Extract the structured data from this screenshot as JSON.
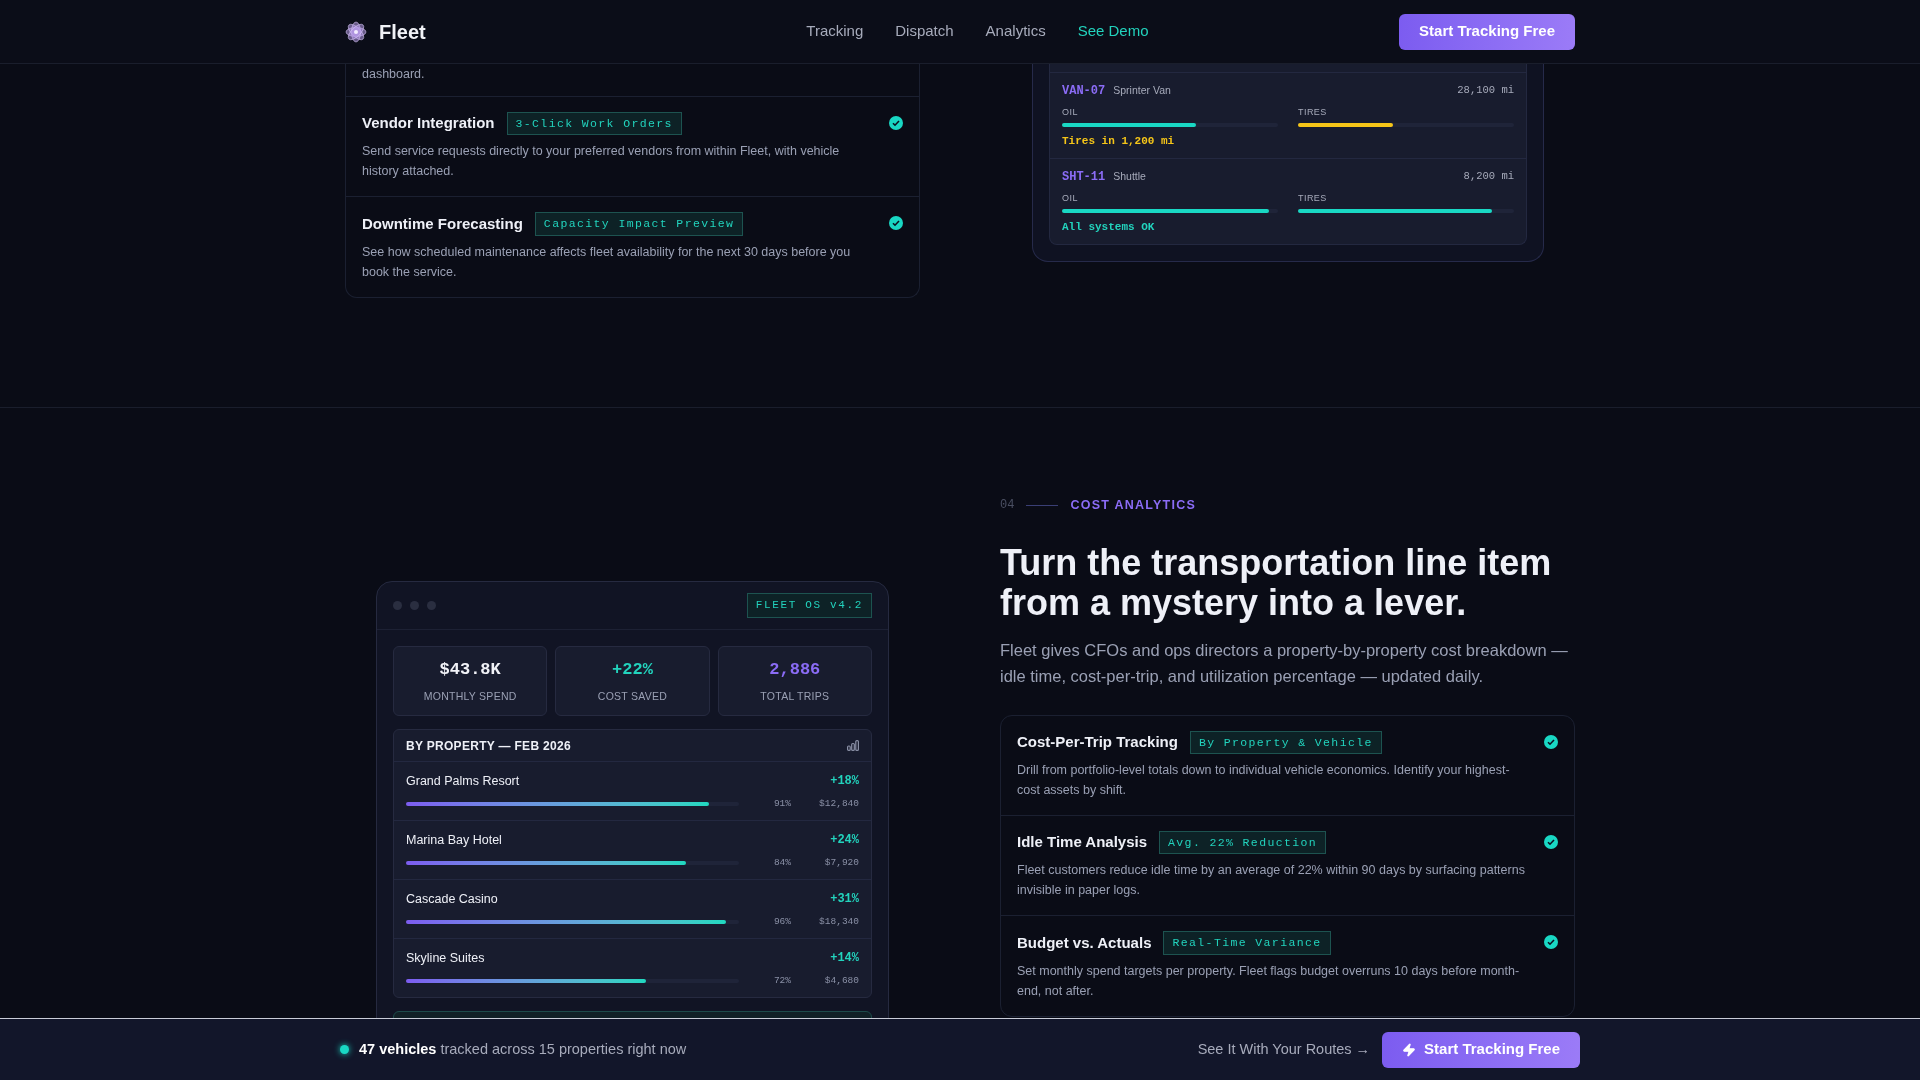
{
  "nav": {
    "brand": "Fleet",
    "links": [
      {
        "label": "Tracking",
        "kind": "plain"
      },
      {
        "label": "Dispatch",
        "kind": "plain"
      },
      {
        "label": "Analytics",
        "kind": "plain"
      },
      {
        "label": "See Demo",
        "kind": "accent"
      }
    ],
    "cta": "Start Tracking Free"
  },
  "maintenance": {
    "partial_description": "dashboard.",
    "features": [
      {
        "title": "Vendor Integration",
        "tag": "3-Click Work Orders",
        "description": "Send service requests directly to your preferred vendors from within Fleet, with vehicle history attached.",
        "checked": true
      },
      {
        "title": "Downtime Forecasting",
        "tag": "Capacity Impact Preview",
        "description": "See how scheduled maintenance affects fleet availability for the next 30 days before you book the service.",
        "checked": true
      }
    ],
    "vehicles": [
      {
        "id": "VAN-07",
        "type": "Sprinter Van",
        "mileage": "28,100 mi",
        "gauges": [
          {
            "label": "OIL",
            "level": 0.62,
            "color": "#19d8c4"
          },
          {
            "label": "TIRES",
            "level": 0.44,
            "color": "#f5c518"
          }
        ],
        "status": {
          "text": "Tires in 1,200 mi",
          "color": "#f5c518"
        }
      },
      {
        "id": "SHT-11",
        "type": "Shuttle",
        "mileage": "8,200 mi",
        "gauges": [
          {
            "label": "OIL",
            "level": 0.96,
            "color": "#19d8c4"
          },
          {
            "label": "TIRES",
            "level": 0.9,
            "color": "#19d8c4"
          }
        ],
        "status": {
          "text": "All systems OK",
          "color": "#22d3bd"
        }
      }
    ]
  },
  "analytics": {
    "number": "04",
    "eyebrow": "COST ANALYTICS",
    "heading": "Turn the transportation line item from a mystery into a lever.",
    "paragraph": "Fleet gives CFOs and ops directors a property-by-property cost breakdown — idle time, cost-per-trip, and utilization percentage — updated daily.",
    "features": [
      {
        "title": "Cost-Per-Trip Tracking",
        "tag": "By Property & Vehicle",
        "description": "Drill from portfolio-level totals down to individual vehicle economics. Identify your highest-cost assets by shift.",
        "checked": true
      },
      {
        "title": "Idle Time Analysis",
        "tag": "Avg. 22% Reduction",
        "description": "Fleet customers reduce idle time by an average of 22% within 90 days by surfacing patterns invisible in paper logs.",
        "checked": true
      },
      {
        "title": "Budget vs. Actuals",
        "tag": "Real-Time Variance",
        "description": "Set monthly spend targets per property. Fleet flags budget overruns 10 days before month-end, not after.",
        "checked": true
      }
    ]
  },
  "dashboard": {
    "badge": "FLEET OS v4.2",
    "stats": [
      {
        "value": "$43.8K",
        "label": "MONTHLY SPEND",
        "kind": "neutral"
      },
      {
        "value": "+22%",
        "label": "COST SAVED",
        "kind": "positive"
      },
      {
        "value": "2,886",
        "label": "TOTAL TRIPS",
        "kind": "accent"
      }
    ],
    "panel_title": "BY PROPERTY — FEB 2026",
    "rows": [
      {
        "name": "Grand Palms Resort",
        "change": "+18%",
        "level": 0.91,
        "percent": "91%",
        "amount": "$12,840"
      },
      {
        "name": "Marina Bay Hotel",
        "change": "+24%",
        "level": 0.84,
        "percent": "84%",
        "amount": "$7,920"
      },
      {
        "name": "Cascade Casino",
        "change": "+31%",
        "level": 0.96,
        "percent": "96%",
        "amount": "$18,340"
      },
      {
        "name": "Skyline Suites",
        "change": "+14%",
        "level": 0.72,
        "percent": "72%",
        "amount": "$4,680"
      }
    ]
  },
  "bottom_bar": {
    "message": "**47 vehicles** tracked across 15 properties right now",
    "link": "See It With Your Routes →",
    "cta": "Start Tracking Free"
  }
}
